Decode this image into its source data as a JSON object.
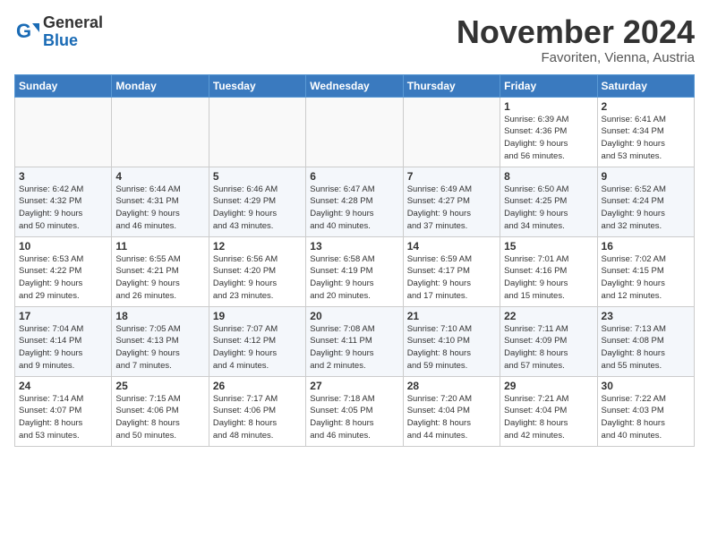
{
  "header": {
    "logo_general": "General",
    "logo_blue": "Blue",
    "month_title": "November 2024",
    "location": "Favoriten, Vienna, Austria"
  },
  "calendar": {
    "columns": [
      "Sunday",
      "Monday",
      "Tuesday",
      "Wednesday",
      "Thursday",
      "Friday",
      "Saturday"
    ],
    "weeks": [
      [
        {
          "day": "",
          "info": ""
        },
        {
          "day": "",
          "info": ""
        },
        {
          "day": "",
          "info": ""
        },
        {
          "day": "",
          "info": ""
        },
        {
          "day": "",
          "info": ""
        },
        {
          "day": "1",
          "info": "Sunrise: 6:39 AM\nSunset: 4:36 PM\nDaylight: 9 hours\nand 56 minutes."
        },
        {
          "day": "2",
          "info": "Sunrise: 6:41 AM\nSunset: 4:34 PM\nDaylight: 9 hours\nand 53 minutes."
        }
      ],
      [
        {
          "day": "3",
          "info": "Sunrise: 6:42 AM\nSunset: 4:32 PM\nDaylight: 9 hours\nand 50 minutes."
        },
        {
          "day": "4",
          "info": "Sunrise: 6:44 AM\nSunset: 4:31 PM\nDaylight: 9 hours\nand 46 minutes."
        },
        {
          "day": "5",
          "info": "Sunrise: 6:46 AM\nSunset: 4:29 PM\nDaylight: 9 hours\nand 43 minutes."
        },
        {
          "day": "6",
          "info": "Sunrise: 6:47 AM\nSunset: 4:28 PM\nDaylight: 9 hours\nand 40 minutes."
        },
        {
          "day": "7",
          "info": "Sunrise: 6:49 AM\nSunset: 4:27 PM\nDaylight: 9 hours\nand 37 minutes."
        },
        {
          "day": "8",
          "info": "Sunrise: 6:50 AM\nSunset: 4:25 PM\nDaylight: 9 hours\nand 34 minutes."
        },
        {
          "day": "9",
          "info": "Sunrise: 6:52 AM\nSunset: 4:24 PM\nDaylight: 9 hours\nand 32 minutes."
        }
      ],
      [
        {
          "day": "10",
          "info": "Sunrise: 6:53 AM\nSunset: 4:22 PM\nDaylight: 9 hours\nand 29 minutes."
        },
        {
          "day": "11",
          "info": "Sunrise: 6:55 AM\nSunset: 4:21 PM\nDaylight: 9 hours\nand 26 minutes."
        },
        {
          "day": "12",
          "info": "Sunrise: 6:56 AM\nSunset: 4:20 PM\nDaylight: 9 hours\nand 23 minutes."
        },
        {
          "day": "13",
          "info": "Sunrise: 6:58 AM\nSunset: 4:19 PM\nDaylight: 9 hours\nand 20 minutes."
        },
        {
          "day": "14",
          "info": "Sunrise: 6:59 AM\nSunset: 4:17 PM\nDaylight: 9 hours\nand 17 minutes."
        },
        {
          "day": "15",
          "info": "Sunrise: 7:01 AM\nSunset: 4:16 PM\nDaylight: 9 hours\nand 15 minutes."
        },
        {
          "day": "16",
          "info": "Sunrise: 7:02 AM\nSunset: 4:15 PM\nDaylight: 9 hours\nand 12 minutes."
        }
      ],
      [
        {
          "day": "17",
          "info": "Sunrise: 7:04 AM\nSunset: 4:14 PM\nDaylight: 9 hours\nand 9 minutes."
        },
        {
          "day": "18",
          "info": "Sunrise: 7:05 AM\nSunset: 4:13 PM\nDaylight: 9 hours\nand 7 minutes."
        },
        {
          "day": "19",
          "info": "Sunrise: 7:07 AM\nSunset: 4:12 PM\nDaylight: 9 hours\nand 4 minutes."
        },
        {
          "day": "20",
          "info": "Sunrise: 7:08 AM\nSunset: 4:11 PM\nDaylight: 9 hours\nand 2 minutes."
        },
        {
          "day": "21",
          "info": "Sunrise: 7:10 AM\nSunset: 4:10 PM\nDaylight: 8 hours\nand 59 minutes."
        },
        {
          "day": "22",
          "info": "Sunrise: 7:11 AM\nSunset: 4:09 PM\nDaylight: 8 hours\nand 57 minutes."
        },
        {
          "day": "23",
          "info": "Sunrise: 7:13 AM\nSunset: 4:08 PM\nDaylight: 8 hours\nand 55 minutes."
        }
      ],
      [
        {
          "day": "24",
          "info": "Sunrise: 7:14 AM\nSunset: 4:07 PM\nDaylight: 8 hours\nand 53 minutes."
        },
        {
          "day": "25",
          "info": "Sunrise: 7:15 AM\nSunset: 4:06 PM\nDaylight: 8 hours\nand 50 minutes."
        },
        {
          "day": "26",
          "info": "Sunrise: 7:17 AM\nSunset: 4:06 PM\nDaylight: 8 hours\nand 48 minutes."
        },
        {
          "day": "27",
          "info": "Sunrise: 7:18 AM\nSunset: 4:05 PM\nDaylight: 8 hours\nand 46 minutes."
        },
        {
          "day": "28",
          "info": "Sunrise: 7:20 AM\nSunset: 4:04 PM\nDaylight: 8 hours\nand 44 minutes."
        },
        {
          "day": "29",
          "info": "Sunrise: 7:21 AM\nSunset: 4:04 PM\nDaylight: 8 hours\nand 42 minutes."
        },
        {
          "day": "30",
          "info": "Sunrise: 7:22 AM\nSunset: 4:03 PM\nDaylight: 8 hours\nand 40 minutes."
        }
      ]
    ]
  }
}
